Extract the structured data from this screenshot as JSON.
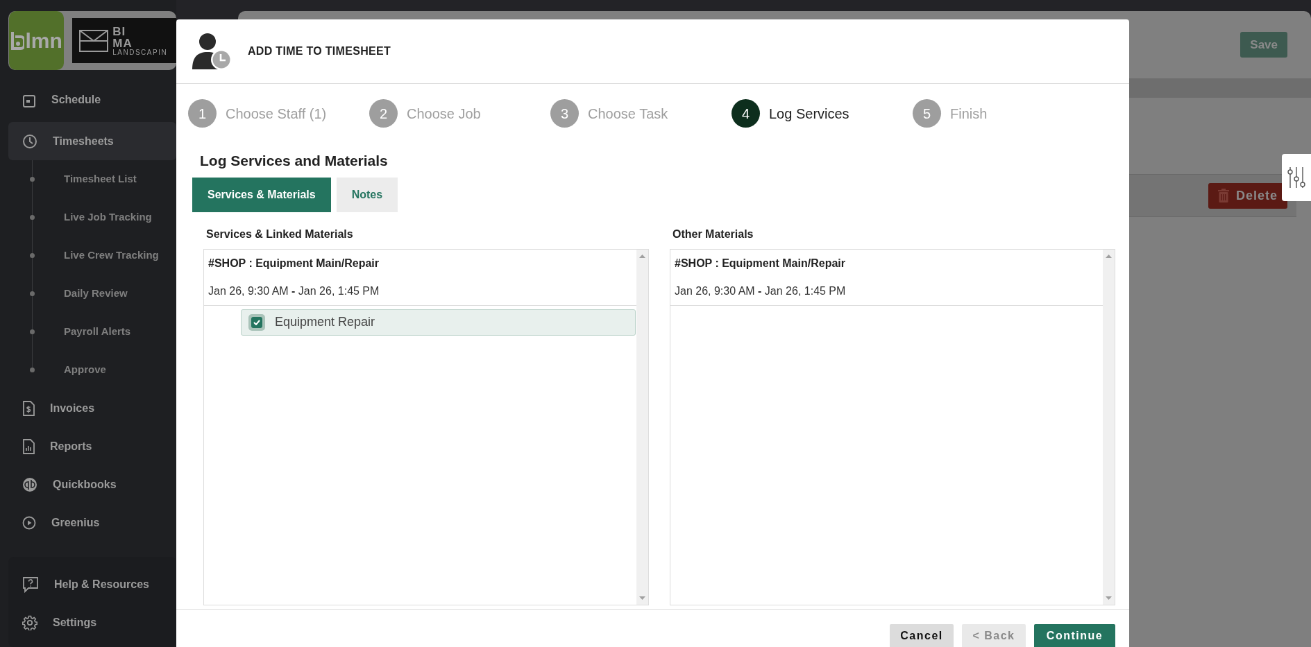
{
  "sidebar": {
    "brand": {
      "logo_text": "lmn",
      "partner_lines": [
        "BI",
        "MA",
        "LANDSCAPIN"
      ]
    },
    "items": [
      {
        "label": "Schedule",
        "selected": false
      },
      {
        "label": "Timesheets",
        "selected": true,
        "children": [
          {
            "label": "Timesheet List",
            "selected": false
          },
          {
            "label": "Live Job Tracking",
            "selected": false
          },
          {
            "label": "Live Crew Tracking",
            "selected": false
          },
          {
            "label": "Daily Review",
            "selected": false
          },
          {
            "label": "Payroll Alerts",
            "selected": false
          },
          {
            "label": "Approve",
            "selected": false
          }
        ]
      },
      {
        "label": "Invoices",
        "selected": false
      },
      {
        "label": "Reports",
        "selected": false
      },
      {
        "label": "Quickbooks",
        "selected": false
      },
      {
        "label": "Greenius",
        "selected": false
      }
    ],
    "bottom_items": [
      {
        "label": "Help & Resources",
        "selected": false
      },
      {
        "label": "Settings",
        "selected": false
      }
    ]
  },
  "page": {
    "save_button": "Save",
    "delete_button": "Delete"
  },
  "modal": {
    "title": "ADD TIME TO TIMESHEET",
    "steps": [
      {
        "number": "1",
        "label": "Choose Staff (1)",
        "selected": false
      },
      {
        "number": "2",
        "label": "Choose Job",
        "selected": false
      },
      {
        "number": "3",
        "label": "Choose Task",
        "selected": false
      },
      {
        "number": "4",
        "label": "Log Services",
        "selected": true
      },
      {
        "number": "5",
        "label": "Finish",
        "selected": false
      }
    ],
    "heading": "Log Services and Materials",
    "tabs": [
      {
        "label": "Services & Materials",
        "selected": true
      },
      {
        "label": "Notes",
        "selected": false
      }
    ],
    "panels": [
      {
        "title": "Services & Linked Materials",
        "group": "#SHOP : Equipment Main/Repair",
        "time": "Jan 26, 9:30 AM **-** Jan 26, 1:45 PM",
        "items": [
          {
            "label": "Equipment Repair",
            "checked": true
          }
        ]
      },
      {
        "title": "Other Materials",
        "group": "#SHOP : Equipment Main/Repair",
        "time": "Jan 26, 9:30 AM **-** Jan 26, 1:45 PM"
      }
    ],
    "buttons": [
      {
        "label": "Cancel",
        "kind": "secondary",
        "disabled": false
      },
      {
        "label": "< Back",
        "kind": "secondary",
        "disabled": true
      },
      {
        "label": "Continue",
        "kind": "primary",
        "disabled": false
      }
    ]
  }
}
